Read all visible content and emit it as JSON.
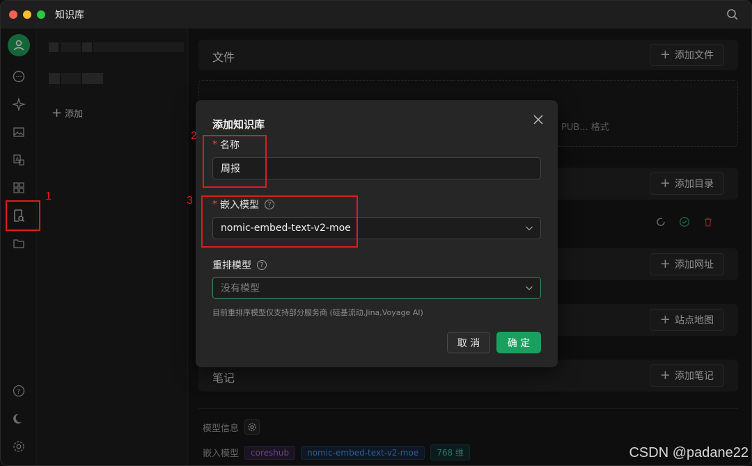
{
  "window": {
    "title": "知识库"
  },
  "kb_panel": {
    "add_label": "添加"
  },
  "main": {
    "files": {
      "title": "文件",
      "add_button": "添加文件",
      "drop_text": "PUB... 格式"
    },
    "directory": {
      "add_button": "添加目录"
    },
    "url": {
      "add_button": "添加网址"
    },
    "sitemap": {
      "add_button": "站点地图"
    },
    "notes": {
      "title": "笔记",
      "add_button": "添加笔记"
    },
    "model_info": {
      "label": "模型信息"
    },
    "embed_row": {
      "label": "嵌入模型",
      "provider_tag": "coreshub",
      "model_tag": "nomic-embed-text-v2-moe",
      "dims_tag": "768 维"
    }
  },
  "modal": {
    "title": "添加知识库",
    "name": {
      "label": "名称",
      "value": "周报",
      "required_mark": "*"
    },
    "embed_model": {
      "label": "嵌入模型",
      "value": "nomic-embed-text-v2-moe",
      "required_mark": "*",
      "help": "?"
    },
    "rerank_model": {
      "label": "重排模型",
      "placeholder": "没有模型",
      "help": "?"
    },
    "hint": "目前重排序模型仅支持部分服务商 (硅基流动,Jina,Voyage AI)",
    "cancel_label": "取 消",
    "ok_label": "确 定"
  },
  "annotations": {
    "n1": "1",
    "n2": "2",
    "n3": "3"
  },
  "watermark": "CSDN @padane22",
  "colors": {
    "accent": "#1aa05e",
    "annotation": "#e01b1b"
  }
}
